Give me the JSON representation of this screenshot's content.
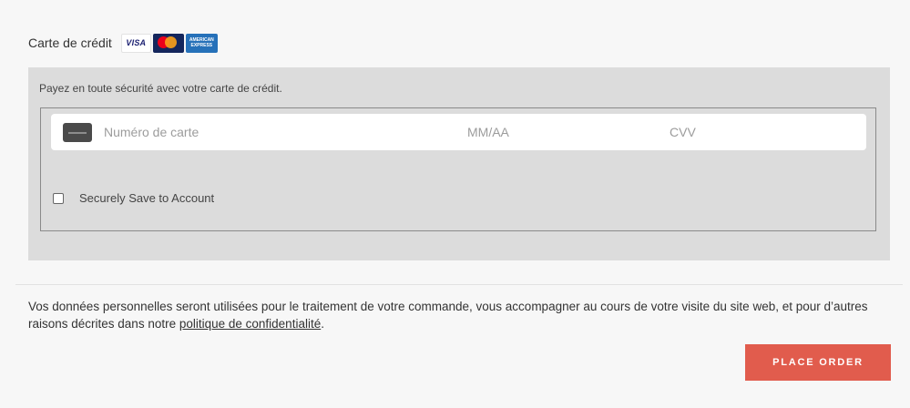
{
  "payment_method": {
    "label": "Carte de crédit",
    "logos": [
      {
        "name": "visa",
        "text": "VISA"
      },
      {
        "name": "mastercard",
        "text": ""
      },
      {
        "name": "american-express",
        "text": "AMERICAN EXPRESS"
      }
    ]
  },
  "payment_box": {
    "secure_text": "Payez en toute sécurité avec votre carte de crédit.",
    "card_number_placeholder": "Numéro de carte",
    "expiry_placeholder": "MM/AA",
    "cvv_placeholder": "CVV",
    "save_label": "Securely Save to Account",
    "save_checked": false
  },
  "privacy": {
    "text_before": "Vos données personnelles seront utilisées pour le traitement de votre commande, vous accompagner au cours de votre visite du site web, et pour d’autres raisons décrites dans notre ",
    "link_label": "politique de confidentialité",
    "text_after": "."
  },
  "actions": {
    "place_order_label": "PLACE ORDER"
  },
  "colors": {
    "accent": "#e15c4d",
    "panel": "#dcdcdc",
    "background": "#f7f7f7"
  },
  "icons": {
    "card": "credit-card-icon"
  }
}
